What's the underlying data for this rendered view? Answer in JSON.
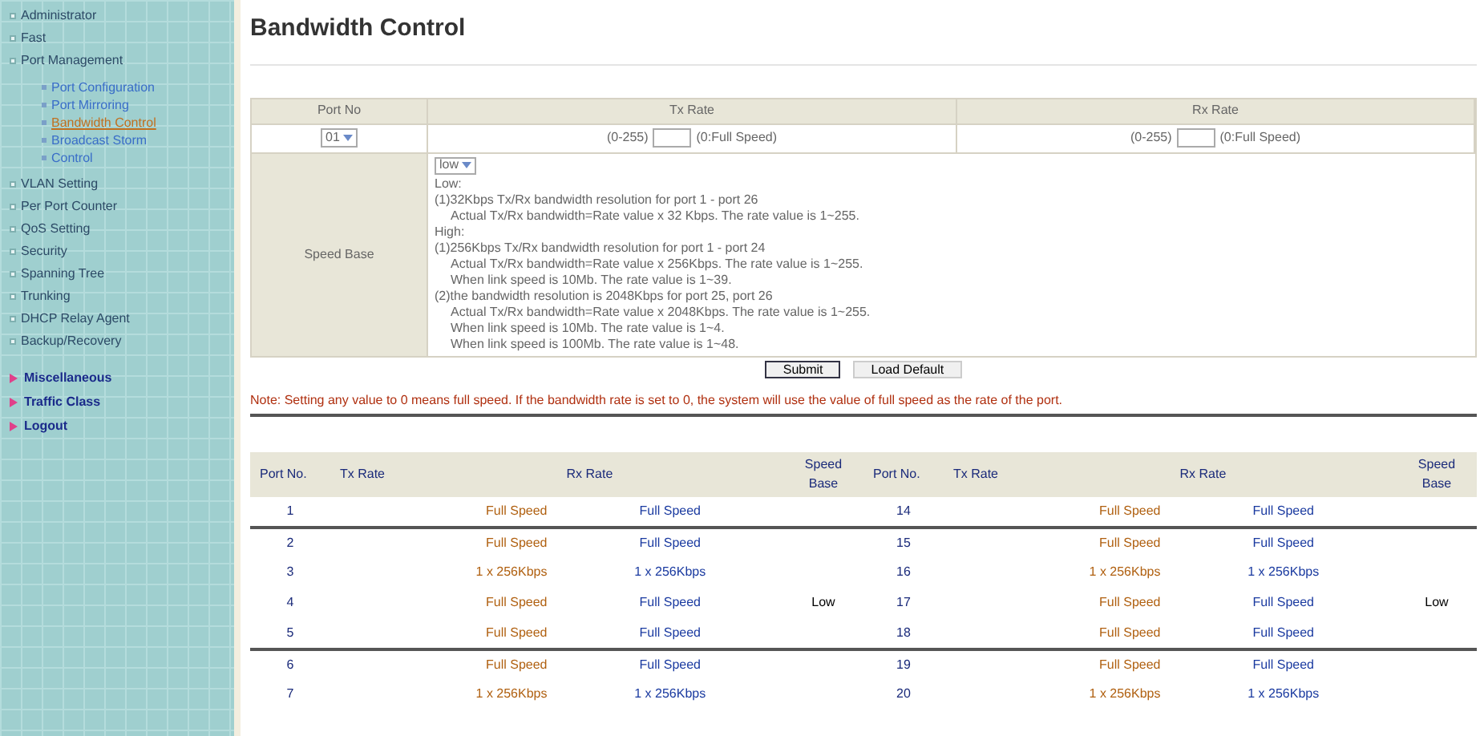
{
  "sidebar": {
    "items": [
      {
        "label": "Administrator",
        "selected": false
      },
      {
        "label": "Fast",
        "selected": false
      },
      {
        "label": "Port Management",
        "selected": false,
        "children": [
          {
            "label": "Port Configuration",
            "selected": false
          },
          {
            "label": "Port Mirroring",
            "selected": false
          },
          {
            "label": "Bandwidth Control",
            "selected": true
          },
          {
            "label": "Broadcast Storm",
            "selected": false
          },
          {
            "label": "Control",
            "selected": false
          }
        ]
      },
      {
        "label": "VLAN Setting",
        "selected": false
      },
      {
        "label": "Per Port Counter",
        "selected": false
      },
      {
        "label": "QoS Setting",
        "selected": false
      },
      {
        "label": "Security",
        "selected": false
      },
      {
        "label": "Spanning Tree",
        "selected": false
      },
      {
        "label": "Trunking",
        "selected": false
      },
      {
        "label": "DHCP Relay Agent",
        "selected": false
      },
      {
        "label": "Backup/Recovery",
        "selected": false
      }
    ],
    "extra_items": [
      {
        "label": "Miscellaneous"
      },
      {
        "label": "Traffic Class"
      },
      {
        "label": "Logout"
      }
    ]
  },
  "title": "Bandwidth Control",
  "form": {
    "columns": [
      "Port No",
      "Tx Rate",
      "Rx Rate"
    ],
    "port": "01",
    "tx_range": "(0-255)",
    "tx_hint": "(0:Full Speed)",
    "rx_range": "(0-255)",
    "rx_hint": "(0:Full Speed)",
    "speed_base_label": "Speed Base",
    "speed_base": "low",
    "speed_lines": [
      {
        "text": "Low:",
        "indent": false
      },
      {
        "text": "(1)32Kbps Tx/Rx bandwidth resolution for port 1 - port 26",
        "indent": false
      },
      {
        "text": "Actual Tx/Rx bandwidth=Rate value x 32 Kbps. The rate value is 1~255.",
        "indent": true
      },
      {
        "text": "High:",
        "indent": false
      },
      {
        "text": "(1)256Kbps Tx/Rx bandwidth resolution for port 1 - port 24",
        "indent": false
      },
      {
        "text": "Actual Tx/Rx bandwidth=Rate value x 256Kbps. The rate value is 1~255.",
        "indent": true
      },
      {
        "text": "When link speed is 10Mb. The rate value is 1~39.",
        "indent": true
      },
      {
        "text": "(2)the bandwidth resolution is 2048Kbps for port 25, port 26",
        "indent": false
      },
      {
        "text": "Actual Tx/Rx bandwidth=Rate value x 2048Kbps. The rate value is 1~255.",
        "indent": true
      },
      {
        "text": "When link speed is 10Mb. The rate value is 1~4.",
        "indent": true
      },
      {
        "text": "When link speed is 100Mb. The rate value is 1~48.",
        "indent": true
      }
    ],
    "buttons": [
      "Submit",
      "Load Default"
    ]
  },
  "note": "Note: Setting any value to 0 means full speed. If the bandwidth rate is set to 0, the system will use the value of full speed as the rate of the port.",
  "table": {
    "columns": [
      "Port No.",
      "Tx Rate",
      "Rx Rate",
      "Speed Base",
      "Port No.",
      "Tx Rate",
      "Rx Rate",
      "Speed Base"
    ],
    "row_groups": [
      {
        "rows": [
          {
            "cells": [
              "1",
              "Full Speed",
              "Full Speed",
              "",
              "14",
              "Full Speed",
              "Full Speed",
              ""
            ]
          }
        ]
      },
      {
        "rows": [
          {
            "cells": [
              "2",
              "Full Speed",
              "Full Speed",
              "",
              "15",
              "Full Speed",
              "Full Speed",
              ""
            ]
          },
          {
            "cells": [
              "3",
              "1 x 256Kbps",
              "1 x 256Kbps",
              "",
              "16",
              "1 x 256Kbps",
              "1 x 256Kbps",
              ""
            ]
          },
          {
            "cells": [
              "4",
              "Full Speed",
              "Full Speed",
              "Low",
              "17",
              "Full Speed",
              "Full Speed",
              "Low"
            ]
          },
          {
            "cells": [
              "5",
              "Full Speed",
              "Full Speed",
              "",
              "18",
              "Full Speed",
              "Full Speed",
              ""
            ]
          }
        ]
      },
      {
        "rows": [
          {
            "cells": [
              "6",
              "Full Speed",
              "Full Speed",
              "",
              "19",
              "Full Speed",
              "Full Speed",
              ""
            ]
          },
          {
            "cells": [
              "7",
              "1 x 256Kbps",
              "1 x 256Kbps",
              "",
              "20",
              "1 x 256Kbps",
              "1 x 256Kbps",
              ""
            ]
          }
        ]
      }
    ]
  }
}
